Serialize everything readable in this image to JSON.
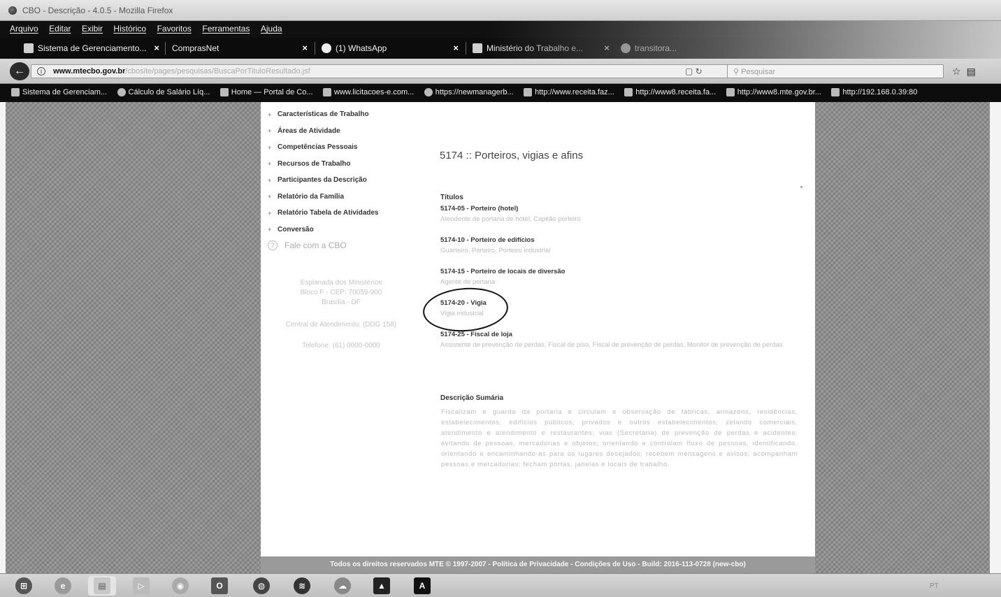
{
  "window": {
    "title": "CBO - Descrição - 4.0.5 - Mozilla Firefox"
  },
  "menubar": {
    "items": [
      "Arquivo",
      "Editar",
      "Exibir",
      "Histórico",
      "Favoritos",
      "Ferramentas",
      "Ajuda"
    ]
  },
  "tabs": [
    {
      "label": "Sistema de Gerenciamento...",
      "icon": "network-icon",
      "closable": true
    },
    {
      "label": "ComprasNet",
      "icon": "",
      "closable": true
    },
    {
      "label": "(1) WhatsApp",
      "icon": "whatsapp-icon",
      "closable": true
    },
    {
      "label": "Ministério do Trabalho e...",
      "icon": "ministry-icon",
      "closable": true
    },
    {
      "label": "transitora...",
      "icon": "globe-icon",
      "closable": false
    }
  ],
  "navbar": {
    "url_host": "www.mtecbo.gov.br",
    "url_path": "/cbosite/pages/pesquisas/BuscaPorTituloResultado.jsf",
    "search_placeholder": "Pesquisar",
    "tools": "▢  ↻"
  },
  "bookmarks": [
    {
      "label": "Sistema de Gerenciam...",
      "icon": "network-icon"
    },
    {
      "label": "Cálculo de Salário Líq...",
      "icon": "globe-icon"
    },
    {
      "label": "Home — Portal de Co...",
      "icon": "portal-icon"
    },
    {
      "label": "www.licitacoes-e.com...",
      "icon": "page-icon"
    },
    {
      "label": "https://newmanagerb...",
      "icon": "globe-icon"
    },
    {
      "label": "http://www.receita.faz...",
      "icon": "mail-icon"
    },
    {
      "label": "http://www8.receita.fa...",
      "icon": "mail-icon"
    },
    {
      "label": "http://www8.mte.gov.br...",
      "icon": "page-icon"
    },
    {
      "label": "http://192.168.0.39:80",
      "icon": "page-icon"
    }
  ],
  "left_nav": {
    "items": [
      "Características de Trabalho",
      "Áreas de Atividade",
      "Competências Pessoais",
      "Recursos de Trabalho",
      "Participantes da Descrição",
      "Relatório da Família",
      "Relatório Tabela de Atividades",
      "Conversão"
    ],
    "fale": "Fale com a CBO",
    "address": [
      "Esplanada dos Ministérios",
      "Bloco F - CEP: 70059-900",
      "Brasília - DF"
    ],
    "hours": "Central de Atendimento: (DDG 158)",
    "phone": "Telefone: (61) 0000-0000"
  },
  "main": {
    "occupation_title": "5174 :: Porteiros, vigias e afins",
    "titles_label": "Títulos",
    "entries": [
      {
        "code": "5174-05 - Porteiro (hotel)",
        "synonyms": "Atendente de portaria de hotel, Capitão porteiro"
      },
      {
        "code": "5174-10 - Porteiro de edifícios",
        "synonyms": "Guarteiro, Porteiro, Porteiro industrial"
      },
      {
        "code": "5174-15 - Porteiro de locais de diversão",
        "synonyms": "Agente de portaria"
      },
      {
        "code": "5174-20 - Vigia",
        "synonyms": "Vigia industrial"
      },
      {
        "code": "5174-25 - Fiscal de loja",
        "synonyms": "Assistente de prevenção de perdas, Fiscal de piso, Fiscal de prevenção de perdas, Monitor de prevenção de perdas"
      }
    ],
    "desc_label": "Descrição Sumária",
    "desc_text": "Fiscalizam e guarda da portaria e circulam e observação de fábricas, armazéns, residências, estabelecimentos, edifícios públicos, privados e outros estabelecimentos; zelando comerciais, atendimento e atendimento e restaurantes; vias (Secretaria) de prevenção de perdas e acidentes; evitando de pessoas, mercadorias e objetos; orientando e controlam fluxo de pessoas, identificando, orientando e encaminhando-as para os lugares desejados; recebem mensagens e avisos; acompanham pessoas e mercadorias; fecham portas, janelas e locais de trabalho."
  },
  "footer": {
    "text": "Todos os direitos reservados MTE © 1997-2007 - Política de Privacidade - Condições de Uso - Build: 2016-113-0728 (new-cbo)"
  },
  "taskbar": {
    "apps": [
      {
        "name": "start-button",
        "glyph": "⊞"
      },
      {
        "name": "internet-explorer-icon",
        "glyph": "e"
      },
      {
        "name": "file-explorer-icon",
        "glyph": "▤"
      },
      {
        "name": "media-player-icon",
        "glyph": "▷"
      },
      {
        "name": "chrome-icon",
        "glyph": "◉"
      },
      {
        "name": "outlook-icon",
        "glyph": "O"
      },
      {
        "name": "firefox-icon",
        "glyph": "◍"
      },
      {
        "name": "spotify-icon",
        "glyph": "≋"
      },
      {
        "name": "cloud-app-icon",
        "glyph": "☁"
      },
      {
        "name": "photos-icon",
        "glyph": "▲"
      },
      {
        "name": "acrobat-icon",
        "glyph": "A"
      }
    ],
    "tray_text": "PT"
  }
}
